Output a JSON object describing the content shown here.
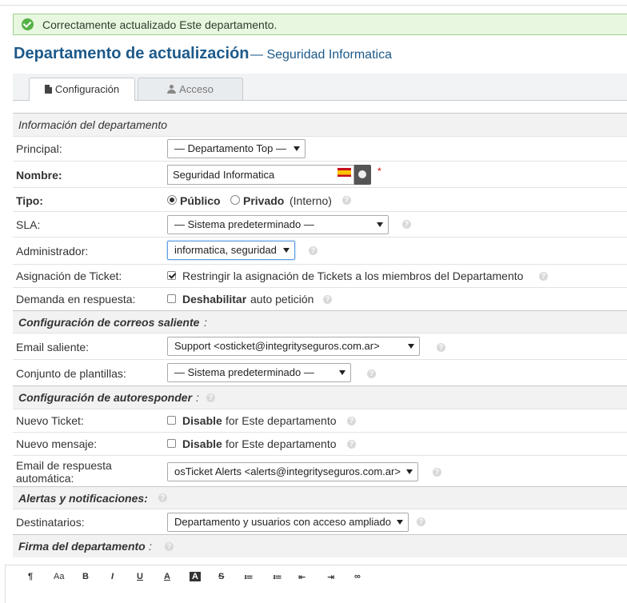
{
  "alert": {
    "message": "Correctamente actualizado Este departamento."
  },
  "header": {
    "title": "Departamento de actualización",
    "subtitle": "— Seguridad Informatica"
  },
  "tabs": [
    {
      "label": "Configuración",
      "active": true
    },
    {
      "label": "Acceso",
      "active": false
    }
  ],
  "sections": {
    "info": "Información del departamento",
    "email": "Configuración de correos saliente",
    "autoresponder": "Configuración de autoresponder",
    "alerts": "Alertas y notificaciones:",
    "signature": "Firma del departamento"
  },
  "fields": {
    "principal": {
      "label": "Principal:",
      "value": "— Departamento Top —"
    },
    "nombre": {
      "label": "Nombre:",
      "value": "Seguridad Informatica",
      "required": "*"
    },
    "tipo": {
      "label": "Tipo:",
      "public": "Público",
      "private": "Privado",
      "private_note": "(Interno)"
    },
    "sla": {
      "label": "SLA:",
      "value": "— Sistema predeterminado —"
    },
    "admin": {
      "label": "Administrador:",
      "value": "informatica, seguridad"
    },
    "assign": {
      "label": "Asignación de Ticket:",
      "text": "Restringir la asignación de Tickets a los miembros del Departamento"
    },
    "claim": {
      "label": "Demanda en respuesta:",
      "bold": "Deshabilitar",
      "text": "auto petición"
    },
    "email_out": {
      "label": "Email saliente:",
      "value": "Support <osticket@integrityseguros.com.ar>"
    },
    "templates": {
      "label": "Conjunto de plantillas:",
      "value": "— Sistema predeterminado —"
    },
    "new_ticket": {
      "label": "Nuevo Ticket:",
      "bold": "Disable",
      "text": "for Este departamento"
    },
    "new_message": {
      "label": "Nuevo mensaje:",
      "bold": "Disable",
      "text": "for Este departamento"
    },
    "auto_email": {
      "label_1": "Email de respuesta",
      "label_2": "automática:",
      "value": "osTicket Alerts <alerts@integrityseguros.com.ar>"
    },
    "recipients": {
      "label": "Destinatarios:",
      "value": "Departamento y usuarios con acceso ampliado"
    }
  },
  "help_glyph": "?",
  "toolbar": [
    "¶",
    "Aa",
    "B",
    "I",
    "U",
    "A",
    "A",
    "S",
    "≔",
    "≔",
    "⇤",
    "⇥",
    "∞"
  ]
}
